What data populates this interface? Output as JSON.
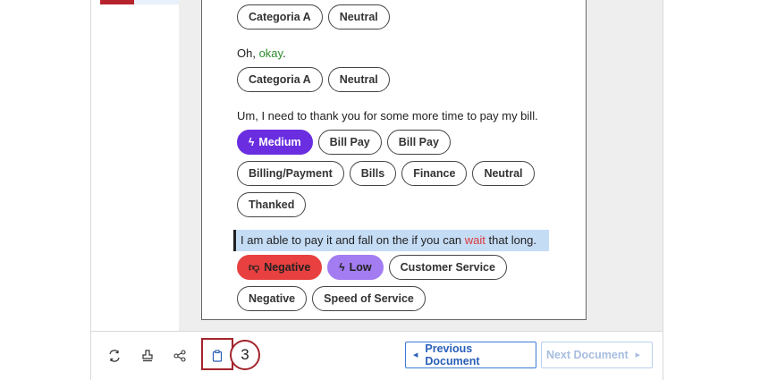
{
  "transcript": {
    "s1": {
      "chips": [
        "Categoria A",
        "Neutral"
      ]
    },
    "s2": {
      "pre": "Oh, ",
      "keyword": "okay",
      "post": ".",
      "chips": [
        "Categoria A",
        "Neutral"
      ]
    },
    "s3": {
      "text": "Um, I need to thank you for some more time to pay my bill.",
      "effort": "Medium",
      "row1": [
        "Bill Pay",
        "Bill Pay"
      ],
      "row2": [
        "Billing/Payment",
        "Bills",
        "Finance",
        "Neutral"
      ],
      "row3": [
        "Thanked"
      ]
    },
    "s4": {
      "pre": "I am able to pay it and fall on the if you can ",
      "keyword": "wait",
      "post": " that long.",
      "sentiment": "Negative",
      "effort": "Low",
      "topic": "Customer Service",
      "row2": [
        "Negative",
        "Speed of Service"
      ]
    }
  },
  "toolbar": {
    "icons": [
      "translate-icon",
      "stamp-icon",
      "share-icon",
      "clipboard-icon"
    ],
    "callout_number": "3"
  },
  "navigation": {
    "previous_label": "Previous Document",
    "next_label": "Next Document"
  },
  "colors": {
    "highlight": "#c5dcf5",
    "medium_effort": "#6a2ee0",
    "low_effort": "#a27cf0",
    "negative": "#e84040",
    "callout": "#a3252c"
  }
}
